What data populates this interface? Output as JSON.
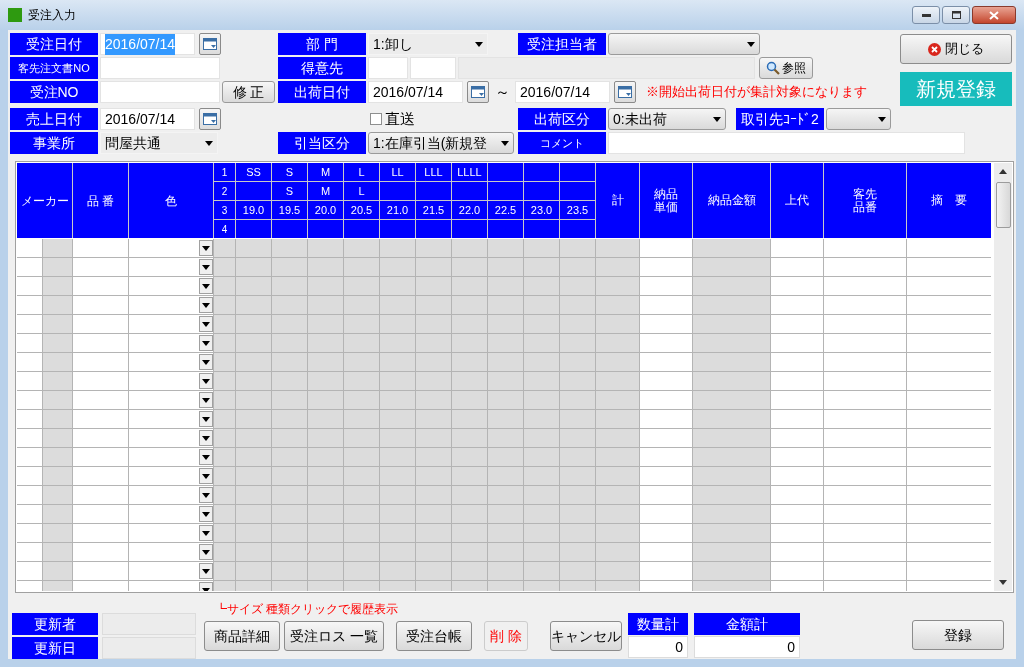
{
  "window": {
    "title": "受注入力"
  },
  "form": {
    "order_date": {
      "label": "受注日付",
      "value": "2016/07/14",
      "selected": true
    },
    "customer_order_no": {
      "label": "客先注文書NO"
    },
    "order_no": {
      "label": "受注NO"
    },
    "fix_button": "修 正",
    "sales_date": {
      "label": "売上日付",
      "value": "2016/07/14"
    },
    "office": {
      "label": "事業所",
      "value": "問屋共通"
    },
    "department": {
      "label": "部 門",
      "value": "1:卸し"
    },
    "customer": {
      "label": "得意先"
    },
    "ship_date": {
      "label": "出荷日付",
      "from": "2016/07/14",
      "separator": "～",
      "to": "2016/07/14"
    },
    "direct": {
      "label": "直送",
      "checked": false
    },
    "allocation": {
      "label": "引当区分",
      "value": "1:在庫引当(新規登"
    },
    "staff": {
      "label": "受注担当者"
    },
    "lookup_button": "参照",
    "note": "※開始出荷日付が集計対象になります",
    "ship_status": {
      "label": "出荷区分",
      "value": "0:未出荷"
    },
    "partner_code2": {
      "label": "取引先ｺｰﾄﾞ2"
    },
    "comment": {
      "label": "コメント"
    }
  },
  "close_button": "閉じる",
  "mode_badge": "新規登録",
  "grid": {
    "left_columns": [
      "メーカー",
      "品 番",
      "色"
    ],
    "row_indexes": [
      "1",
      "2",
      "3",
      "4"
    ],
    "size_columns": [
      {
        "row_1": "SS",
        "row_3": "19.0"
      },
      {
        "row_1": "S",
        "row_2": "S",
        "row_3": "19.5"
      },
      {
        "row_1": "M",
        "row_2": "M",
        "row_3": "20.0"
      },
      {
        "row_1": "L",
        "row_2": "L",
        "row_3": "20.5"
      },
      {
        "row_1": "LL",
        "row_3": "21.0"
      },
      {
        "row_1": "LLL",
        "row_3": "21.5"
      },
      {
        "row_1": "LLLL",
        "row_3": "22.0"
      },
      {
        "row_3": "22.5"
      },
      {
        "row_3": "23.0"
      },
      {
        "row_3": "23.5"
      }
    ],
    "right_columns": [
      {
        "lines": [
          "計"
        ]
      },
      {
        "lines": [
          "納品",
          "単価"
        ]
      },
      {
        "lines": [
          "納品金額"
        ]
      },
      {
        "lines": [
          "上代"
        ]
      },
      {
        "lines": [
          "客先",
          "品番"
        ]
      },
      {
        "lines": [
          "摘　要"
        ]
      }
    ]
  },
  "grid_note": "┗サイズ 種類クリックで履歴表示",
  "footer": {
    "updated_by": {
      "label": "更新者"
    },
    "updated_on": {
      "label": "更新日"
    },
    "buttons": [
      {
        "label": "商品詳細",
        "kind": "normal"
      },
      {
        "label": "受注ロス 一覧",
        "kind": "normal"
      },
      {
        "label": "受注台帳",
        "kind": "normal"
      },
      {
        "label": "削 除",
        "kind": "danger"
      },
      {
        "label": "キャンセル",
        "kind": "normal"
      }
    ],
    "qty_total": {
      "label": "数量計",
      "value": "0"
    },
    "amount_total": {
      "label": "金額計",
      "value": "0"
    },
    "register_button": "登録"
  }
}
